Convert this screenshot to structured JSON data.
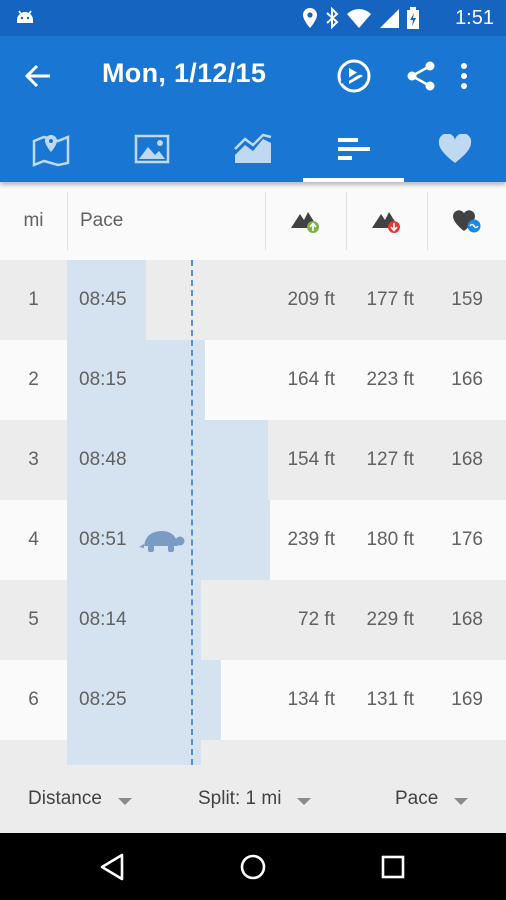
{
  "status": {
    "time": "1:51"
  },
  "appbar": {
    "title": "Mon, 1/12/15"
  },
  "table": {
    "headers": {
      "mi": "mi",
      "pace": "Pace"
    },
    "rows": [
      {
        "mi": "1",
        "pace": "08:45",
        "up": "209 ft",
        "down": "177 ft",
        "hr": "159",
        "pace_fraction": 0.39
      },
      {
        "mi": "2",
        "pace": "08:15",
        "up": "164 ft",
        "down": "223 ft",
        "hr": "166",
        "pace_fraction": 0.68
      },
      {
        "mi": "3",
        "pace": "08:48",
        "up": "154 ft",
        "down": "127 ft",
        "hr": "168",
        "pace_fraction": 0.99
      },
      {
        "mi": "4",
        "pace": "08:51",
        "up": "239 ft",
        "down": "180 ft",
        "hr": "176",
        "pace_fraction": 1.0,
        "slowest": true
      },
      {
        "mi": "5",
        "pace": "08:14",
        "up": "72 ft",
        "down": "229 ft",
        "hr": "168",
        "pace_fraction": 0.66
      },
      {
        "mi": "6",
        "pace": "08:25",
        "up": "134 ft",
        "down": "131 ft",
        "hr": "169",
        "pace_fraction": 0.76
      },
      {
        "mi": "",
        "pace": "",
        "up": "",
        "down": "",
        "hr": "",
        "pace_fraction": 0.66
      }
    ]
  },
  "footer": {
    "distance": "Distance",
    "split": "Split: 1 mi",
    "pace": "Pace"
  },
  "colors": {
    "status_bar": "#1565c0",
    "app_bar": "#1976d2",
    "pace_bar": "#d5e3f1",
    "average_line": "#5c8fca",
    "elevation_up": "#7cb342",
    "elevation_down": "#e53935",
    "heart_rate": "#1e88e5"
  }
}
